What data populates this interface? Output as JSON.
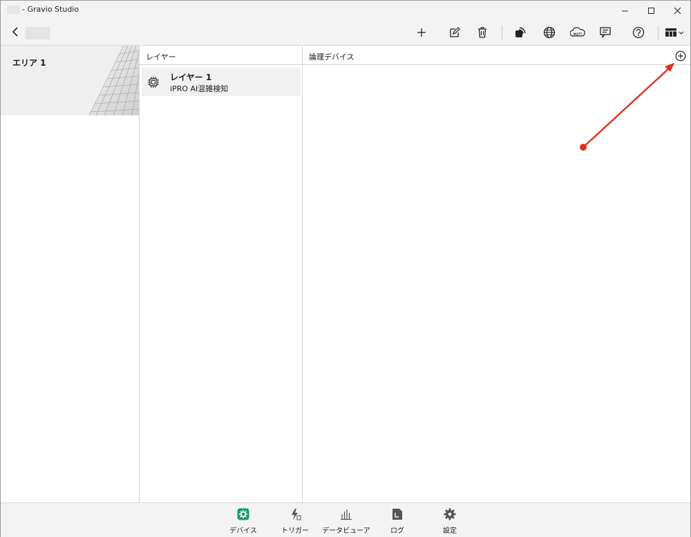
{
  "window": {
    "title": "- Gravio Studio",
    "controls": {
      "minimize": "—",
      "maximize": "☐",
      "close": "✕"
    }
  },
  "toolbar": {
    "icons": [
      "back-icon",
      "add-icon",
      "edit-icon",
      "delete-icon",
      "nfc-icon",
      "globe-icon",
      "mqtt-icon",
      "message-icon",
      "help-icon",
      "layout-icon"
    ],
    "mqtt_label": "MQTT"
  },
  "area_pane": {
    "items": [
      {
        "label": "エリア 1",
        "selected": true
      }
    ]
  },
  "layer_pane": {
    "header": "レイヤー",
    "items": [
      {
        "name": "レイヤー 1",
        "subtitle": "iPRO AI混雑検知",
        "icon": "chip-icon"
      }
    ]
  },
  "device_pane": {
    "header": "論理デバイス",
    "add_icon": "add-circle-icon"
  },
  "bottom_nav": {
    "items": [
      {
        "label": "デバイス",
        "icon": "device-icon",
        "active": true
      },
      {
        "label": "トリガー",
        "icon": "trigger-icon",
        "active": false
      },
      {
        "label": "データビューア",
        "icon": "chart-icon",
        "active": false
      },
      {
        "label": "ログ",
        "icon": "log-icon",
        "active": false
      },
      {
        "label": "設定",
        "icon": "settings-icon",
        "active": false
      }
    ]
  },
  "colors": {
    "accent": "#1a9a73",
    "annotation": "#e0301e",
    "chrome": "#f3f3f3",
    "selected": "#efefef"
  }
}
